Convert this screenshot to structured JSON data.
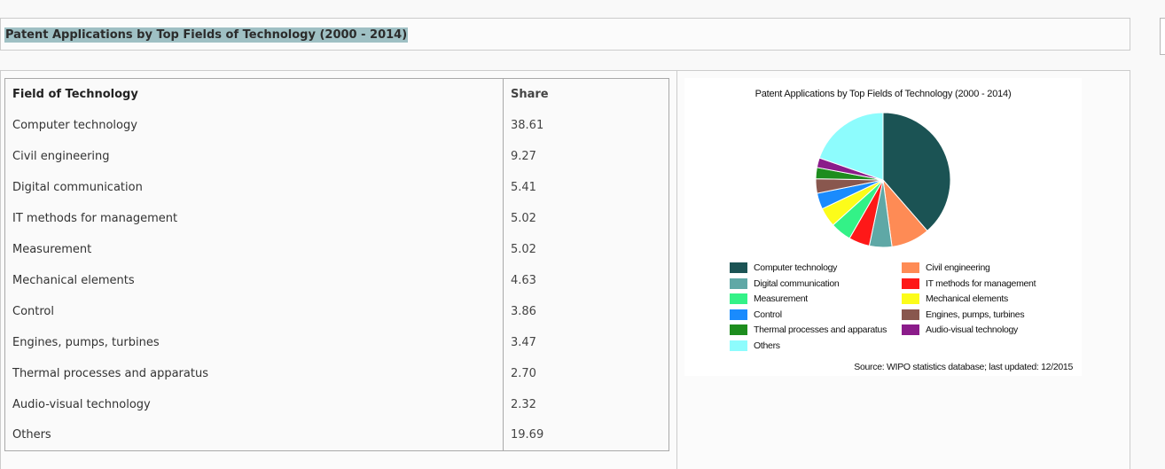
{
  "page": {
    "heading": "Patent Applications by Top Fields of Technology (2000 - 2014)"
  },
  "table": {
    "headers": [
      "Field of Technology",
      "Share"
    ],
    "rows": [
      [
        "Computer technology",
        "38.61"
      ],
      [
        "Civil engineering",
        "9.27"
      ],
      [
        "Digital communication",
        "5.41"
      ],
      [
        "IT methods for management",
        "5.02"
      ],
      [
        "Measurement",
        "5.02"
      ],
      [
        "Mechanical elements",
        "4.63"
      ],
      [
        "Control",
        "3.86"
      ],
      [
        "Engines, pumps, turbines",
        "3.47"
      ],
      [
        "Thermal processes and apparatus",
        "2.70"
      ],
      [
        "Audio-visual technology",
        "2.32"
      ],
      [
        "Others",
        "19.69"
      ]
    ]
  },
  "chart_data": {
    "type": "pie",
    "title": "Patent Applications by Top Fields of Technology (2000 - 2014)",
    "categories": [
      "Computer technology",
      "Civil engineering",
      "Digital communication",
      "IT methods for management",
      "Measurement",
      "Mechanical elements",
      "Control",
      "Engines, pumps, turbines",
      "Thermal processes and apparatus",
      "Audio-visual technology",
      "Others"
    ],
    "values": [
      38.61,
      9.27,
      5.41,
      5.02,
      5.02,
      4.63,
      3.86,
      3.47,
      2.7,
      2.32,
      19.69
    ],
    "colors": [
      "#1b5354",
      "#fe8b55",
      "#5fa8a6",
      "#fe1818",
      "#33f287",
      "#fcfc1a",
      "#1a8bfd",
      "#89574e",
      "#1d8d1e",
      "#8b1c8a",
      "#8dfcfd"
    ],
    "legend_placement": "bottom",
    "source": "Source: WIPO statistics database; last updated: 12/2015"
  }
}
